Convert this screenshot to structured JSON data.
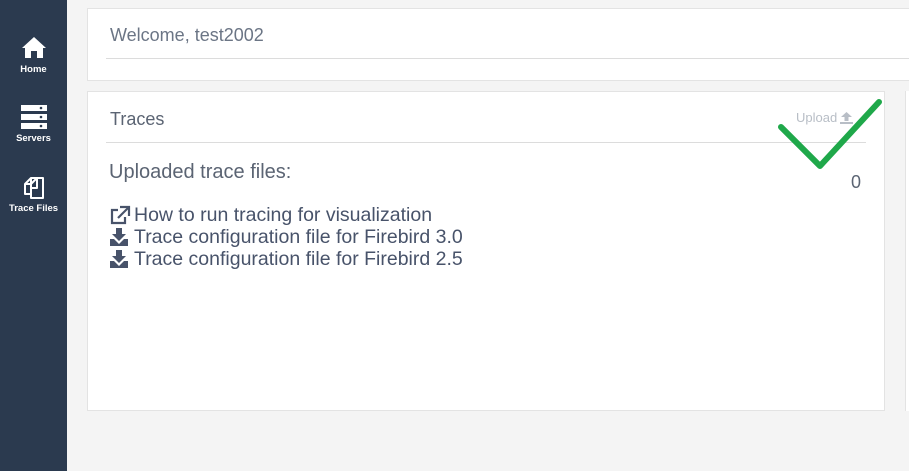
{
  "sidebar": {
    "items": [
      {
        "label": "Home",
        "icon": "home-icon"
      },
      {
        "label": "Servers",
        "icon": "servers-icon"
      },
      {
        "label": "Trace Files",
        "icon": "trace-files-icon"
      }
    ]
  },
  "welcome": {
    "text": "Welcome, test2002"
  },
  "traces": {
    "title": "Traces",
    "upload_label": "Upload",
    "uploaded_label": "Uploaded trace files:",
    "count": "0",
    "links": [
      {
        "icon": "external-link-icon",
        "label": "How to run tracing for visualization"
      },
      {
        "icon": "download-icon",
        "label": "Trace configuration file for Firebird 3.0"
      },
      {
        "icon": "download-icon",
        "label": "Trace configuration file for Firebird 2.5"
      }
    ]
  },
  "colors": {
    "sidebar": "#2b3a4f",
    "background": "#f4f4f4",
    "checkmark": "#1fa84a"
  }
}
